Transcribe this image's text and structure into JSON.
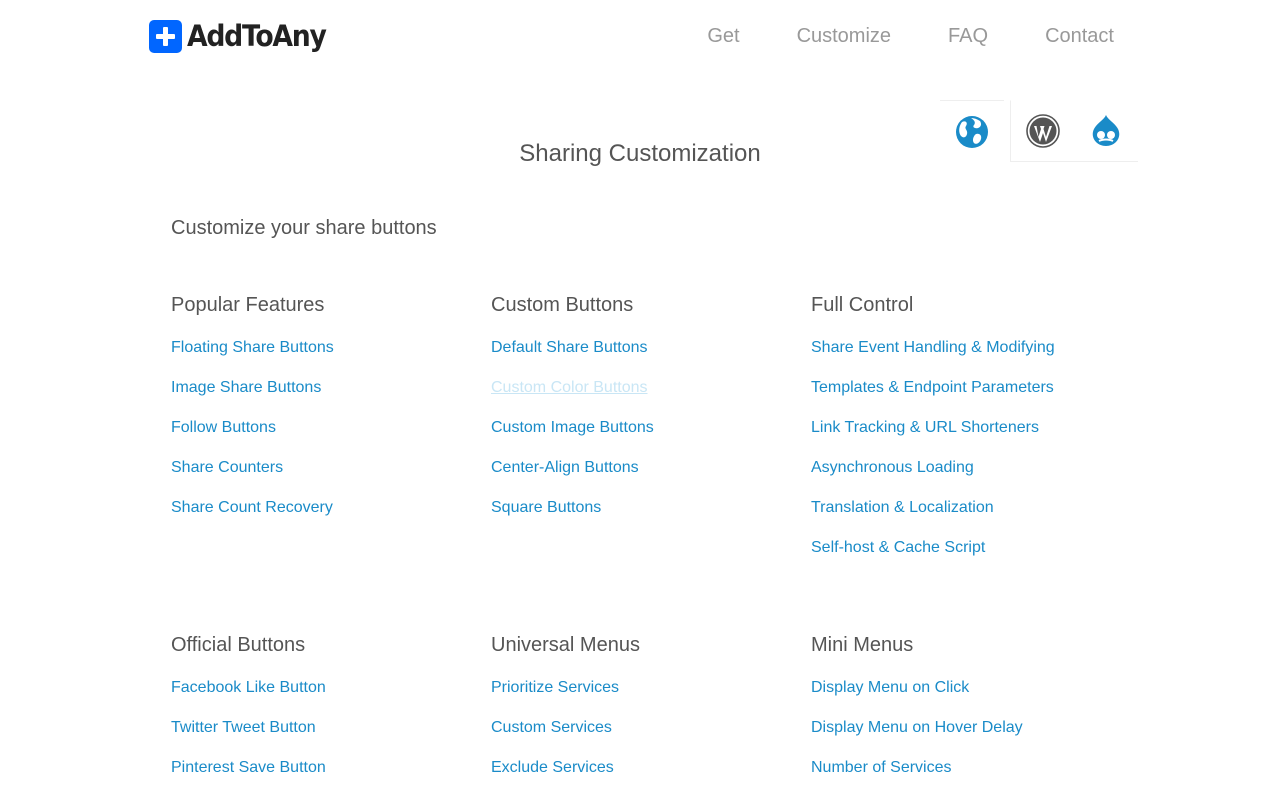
{
  "brand": {
    "name": "AddToAny"
  },
  "nav": [
    {
      "label": "Get"
    },
    {
      "label": "Customize"
    },
    {
      "label": "FAQ"
    },
    {
      "label": "Contact"
    }
  ],
  "platforms": [
    {
      "icon": "globe-icon",
      "active": true,
      "color": "#1a8bc8"
    },
    {
      "icon": "wordpress-icon",
      "active": false,
      "color": "#555555"
    },
    {
      "icon": "drupal-icon",
      "active": false,
      "color": "#1a8bc8"
    }
  ],
  "page_title": "Sharing Customization",
  "intro": "Customize your share buttons",
  "colors": {
    "link": "#1a8bc8",
    "brand": "#0166ff",
    "heading": "#555555",
    "nav": "#999999"
  },
  "sections": [
    {
      "title": "Popular Features",
      "links": [
        "Floating Share Buttons",
        "Image Share Buttons",
        "Follow Buttons",
        "Share Counters",
        "Share Count Recovery"
      ]
    },
    {
      "title": "Custom Buttons",
      "links": [
        "Default Share Buttons",
        "Custom Color Buttons",
        "Custom Image Buttons",
        "Center-Align Buttons",
        "Square Buttons"
      ]
    },
    {
      "title": "Full Control",
      "links": [
        "Share Event Handling & Modifying",
        "Templates & Endpoint Parameters",
        "Link Tracking & URL Shorteners",
        "Asynchronous Loading",
        "Translation & Localization",
        "Self-host & Cache Script"
      ]
    },
    {
      "title": "Official Buttons",
      "links": [
        "Facebook Like Button",
        "Twitter Tweet Button",
        "Pinterest Save Button"
      ]
    },
    {
      "title": "Universal Menus",
      "links": [
        "Prioritize Services",
        "Custom Services",
        "Exclude Services"
      ]
    },
    {
      "title": "Mini Menus",
      "links": [
        "Display Menu on Click",
        "Display Menu on Hover Delay",
        "Number of Services"
      ]
    }
  ]
}
